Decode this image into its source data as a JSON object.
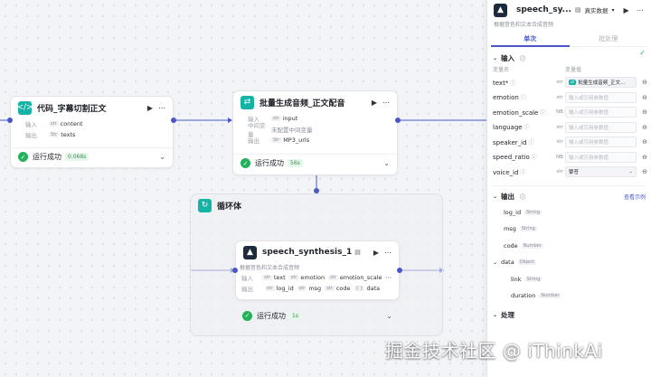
{
  "nodes": {
    "code": {
      "title": "代码_字幕切割正文",
      "in_label": "输入",
      "in_type": "str",
      "in_value": "content",
      "out_label": "输出",
      "out_type": "Str",
      "out_value": "texts",
      "status": "运行成功",
      "time": "0.068s"
    },
    "batch": {
      "title": "批量生成音频_正文配音",
      "in_label": "输入",
      "in_type": "str",
      "in_value": "input",
      "mid_label": "中间变量",
      "mid_value": "未配置中间变量",
      "out_label": "输出",
      "out_type": "Str",
      "out_value": "MP3_urls",
      "status": "运行成功",
      "time": "56s"
    },
    "loop": {
      "title": "循环体"
    },
    "speech": {
      "title": "speech_synthesis_1",
      "desc": "根据音色和文本合成音频",
      "in_label": "输入",
      "in_items": [
        {
          "type": "str",
          "name": "text"
        },
        {
          "type": "str",
          "name": "emotion"
        },
        {
          "type": "str",
          "name": "emotion_scale"
        }
      ],
      "out_label": "输出",
      "out_items": [
        {
          "type": "str",
          "name": "log_id"
        },
        {
          "type": "str",
          "name": "msg"
        },
        {
          "type": "str",
          "name": "code"
        },
        {
          "type": "{ }",
          "name": "data"
        }
      ],
      "status": "运行成功",
      "time": "1s"
    }
  },
  "panel": {
    "title": "speech_sy...",
    "mode": "真实数据",
    "desc": "根据音色和文本合成音频",
    "tabs": [
      "单次",
      "批处理"
    ],
    "input_section": "输入",
    "col_name": "变量名",
    "col_value": "变量值",
    "fields": [
      {
        "name": "text*",
        "type": "str",
        "value": "批量生成音频_正文...",
        "filled": true
      },
      {
        "name": "emotion",
        "type": "str",
        "value": "输入或引用参数值",
        "filled": false
      },
      {
        "name": "emotion_scale",
        "type": "NB",
        "value": "输入或引用参数值",
        "filled": false
      },
      {
        "name": "language",
        "type": "str",
        "value": "输入或引用参数值",
        "filled": false
      },
      {
        "name": "speaker_id",
        "type": "str",
        "value": "输入或引用参数值",
        "filled": false
      },
      {
        "name": "speed_ratio",
        "type": "NB",
        "value": "输入或引用参数值",
        "filled": false
      },
      {
        "name": "voice_id",
        "type": "str",
        "value": "擎苍",
        "filled": true
      }
    ],
    "output_section": "输出",
    "output_link": "查看示例",
    "outputs": [
      {
        "name": "log_id",
        "type": "String",
        "indent": 1
      },
      {
        "name": "msg",
        "type": "String",
        "indent": 1
      },
      {
        "name": "code",
        "type": "Number",
        "indent": 1
      },
      {
        "name": "data",
        "type": "Object",
        "indent": 0
      },
      {
        "name": "link",
        "type": "String",
        "indent": 2
      },
      {
        "name": "duration",
        "type": "Number",
        "indent": 2
      }
    ],
    "process_section": "处理"
  },
  "watermark": "掘金技术社区 @ iThinkAi",
  "colors": {
    "accent": "#4a57c4",
    "success": "#22b25a",
    "teal": "#15b3a6"
  }
}
